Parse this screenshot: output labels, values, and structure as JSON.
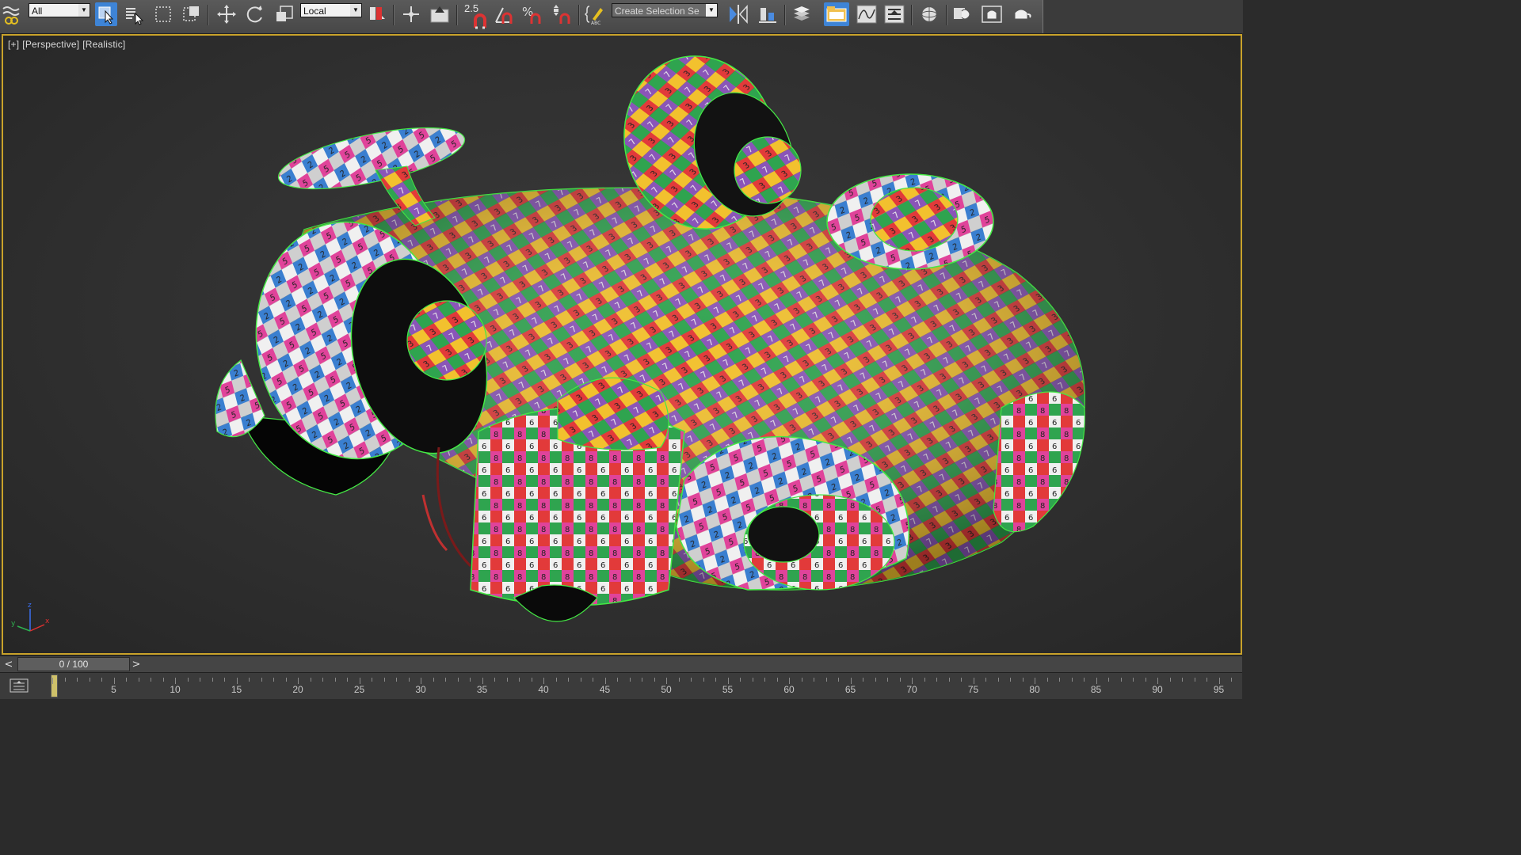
{
  "toolbar": {
    "selection_filter": "All",
    "reference_coord": "Local",
    "snap_value": "2.5",
    "selection_set_placeholder": "Create Selection Se",
    "icons": [
      "undo-history-icon",
      "select-filter-icon",
      "select-object-icon",
      "select-by-name-icon",
      "rect-selection-region-icon",
      "window-crossing-icon",
      "move-icon",
      "rotate-icon",
      "scale-icon",
      "pivot-center-icon",
      "manipulate-icon",
      "keyboard-shortcut-override-icon",
      "snaps-toggle-icon",
      "angle-snap-icon",
      "percent-snap-icon",
      "spinner-snap-icon",
      "edit-named-sets-icon",
      "mirror-icon",
      "align-icon",
      "layer-manager-icon",
      "scene-explorer-icon",
      "curve-editor-icon",
      "schematic-view-icon",
      "material-editor-icon",
      "render-setup-icon",
      "render-frame-window-icon",
      "render-production-icon"
    ]
  },
  "viewport": {
    "labels": [
      "[+]",
      "[Perspective]",
      "[Realistic]"
    ],
    "axis": {
      "z": "z",
      "x": "x",
      "y": "y"
    },
    "accent": "#c9a22a"
  },
  "timeslider": {
    "frame_readout": "0 / 100",
    "prev": "<",
    "next": ">"
  },
  "trackbar": {
    "tick_labels": [
      "5",
      "10",
      "15",
      "20",
      "25",
      "30",
      "35",
      "40",
      "45",
      "50",
      "55",
      "60",
      "65",
      "70",
      "75",
      "80",
      "85",
      "90",
      "95"
    ]
  },
  "colors": {
    "selection_wire": "#44e844",
    "checker": [
      "#e23a3a",
      "#f2c12e",
      "#2fa44f",
      "#8a55b8",
      "#e0439a",
      "#3a7fd0",
      "#cfcfcf",
      "#f0f0f0"
    ]
  }
}
